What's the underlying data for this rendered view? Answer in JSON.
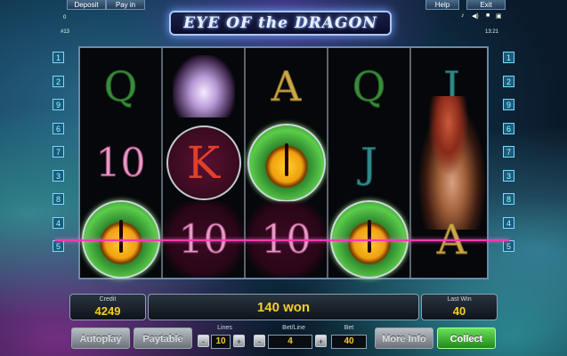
{
  "top_bar": {
    "deposit": "Deposit",
    "pay_in": "Pay in",
    "help": "Help",
    "exit": "Exit",
    "balance_small": "0",
    "round_id": "#13",
    "clock": "13:21"
  },
  "game": {
    "title": "EYE OF the DRAGON"
  },
  "line_numbers_left": [
    "1",
    "2",
    "9",
    "6",
    "7",
    "3",
    "8",
    "4",
    "5"
  ],
  "line_numbers_right": [
    "1",
    "2",
    "9",
    "6",
    "7",
    "3",
    "8",
    "4",
    "5"
  ],
  "reels": [
    {
      "rows": [
        {
          "symbol": "Q",
          "type": "letter-q"
        },
        {
          "symbol": "10",
          "type": "ten"
        },
        {
          "symbol": "eye",
          "type": "eye",
          "label": "dragon eye"
        }
      ]
    },
    {
      "rows": [
        {
          "symbol": "tiger",
          "type": "tiger",
          "label": "white tiger"
        },
        {
          "symbol": "K",
          "type": "king"
        },
        {
          "symbol": "10",
          "type": "ten-win"
        }
      ]
    },
    {
      "rows": [
        {
          "symbol": "A",
          "type": "letter-a"
        },
        {
          "symbol": "eye",
          "type": "eye",
          "label": "dragon eye"
        },
        {
          "symbol": "10",
          "type": "ten-win"
        }
      ]
    },
    {
      "rows": [
        {
          "symbol": "Q",
          "type": "letter-q"
        },
        {
          "symbol": "J",
          "type": "letter-j"
        },
        {
          "symbol": "eye",
          "type": "eye",
          "label": "dragon eye"
        }
      ]
    },
    {
      "rows": [
        {
          "symbol": "J",
          "type": "letter-j"
        },
        {
          "symbol": "huntress",
          "type": "huntress",
          "label": "huntress"
        },
        {
          "symbol": "A",
          "type": "letter-a"
        }
      ]
    }
  ],
  "status": {
    "credit_label": "Credit",
    "credit_value": "4249",
    "win_message": "140 won",
    "last_win_label": "Last Win",
    "last_win_value": "40"
  },
  "controls": {
    "autoplay": "Autoplay",
    "paytable": "Paytable",
    "lines_label": "Lines",
    "lines_value": "10",
    "bet_line_label": "Bet/Line",
    "bet_line_value": "4",
    "bet_label": "Bet",
    "bet_value": "40",
    "more_info": "More Info",
    "collect": "Collect",
    "minus": "-",
    "plus": "+"
  },
  "colors": {
    "accent_gold": "#f5d020",
    "payline": "#ff3ab0",
    "collect_green": "#1f8a1a"
  }
}
